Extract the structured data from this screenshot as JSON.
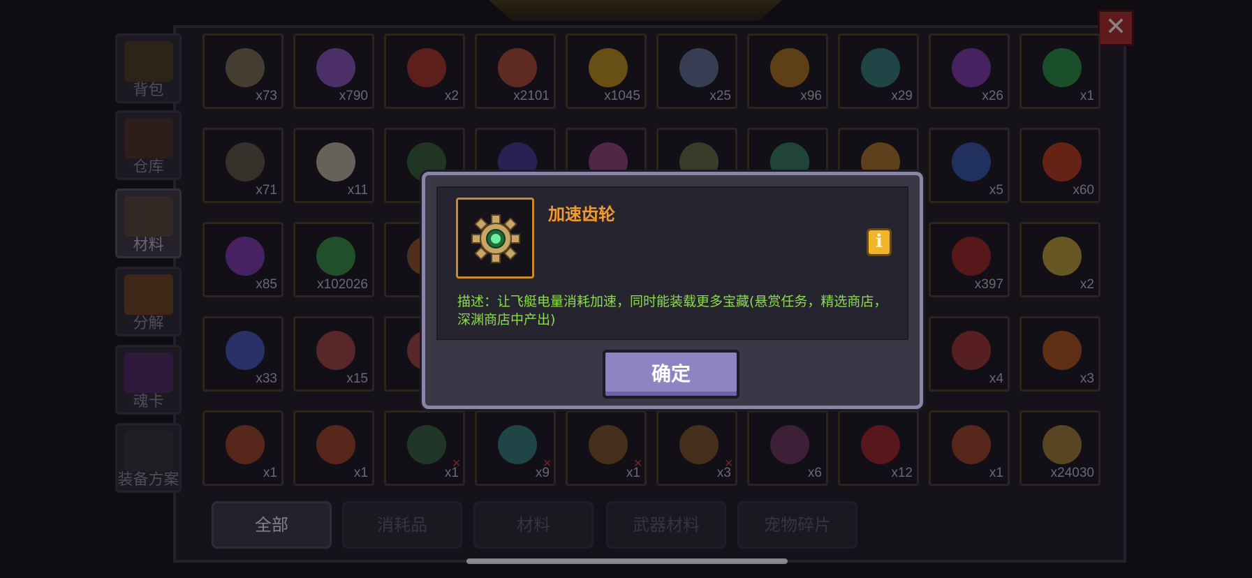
{
  "close_label": "✕",
  "side_tabs": [
    {
      "label": "背包",
      "icon": "chest-icon",
      "color": "#6a4a1a"
    },
    {
      "label": "仓库",
      "icon": "storage-icon",
      "color": "#6a3a1a"
    },
    {
      "label": "材料",
      "icon": "materials-icon",
      "color": "#6a5030"
    },
    {
      "label": "分解",
      "icon": "disassemble-icon",
      "color": "#a05a10"
    },
    {
      "label": "魂卡",
      "icon": "soul-card-icon",
      "color": "#6a2a8a"
    },
    {
      "label": "装备方案",
      "icon": "equipment-plan-icon",
      "color": "#3a3a3a"
    }
  ],
  "active_side_tab": 2,
  "grid": {
    "rows": [
      [
        "x73",
        "x790",
        "x2",
        "x2101",
        "x1045",
        "x25",
        "x96",
        "x29",
        "x26",
        "x1"
      ],
      [
        "x71",
        "x11",
        "",
        "",
        "",
        "",
        "",
        "",
        "x5",
        "x60"
      ],
      [
        "x85",
        "x102026",
        "",
        "",
        "",
        "",
        "",
        "",
        "x397",
        "x2"
      ],
      [
        "x33",
        "x15",
        "",
        "",
        "",
        "",
        "",
        "",
        "x4",
        "x3"
      ],
      [
        "x1",
        "x1",
        "x1",
        "x9",
        "x1",
        "x3",
        "x6",
        "x12",
        "x1",
        "x24030"
      ]
    ],
    "colors": [
      [
        "#8a7a5a",
        "#9a5ad0",
        "#b83a2a",
        "#c0503a",
        "#d0a020",
        "#6a7aa0",
        "#c08020",
        "#3a8a8a",
        "#8a40c0",
        "#2aa04a"
      ],
      [
        "#6a6050",
        "#d0c8b0",
        "#3a6a3a",
        "#4a40a0",
        "#a04a8a",
        "#6a7a4a",
        "#3a8a6a",
        "#c08030",
        "#3a60c0",
        "#d04020"
      ],
      [
        "#8a40c0",
        "#3aa04a",
        "#a05a30",
        "",
        "",
        "",
        "",
        "",
        "#b02a2a",
        "#d0b040"
      ],
      [
        "#4a60d0",
        "#b04a4a",
        "#b04a4a",
        "",
        "",
        "",
        "",
        "",
        "#b03a3a",
        "#c05a20"
      ],
      [
        "#b04a2a",
        "#b04a2a",
        "#3a6a4a",
        "#3a8a8a",
        "#8a5a2a",
        "#8a5a2a",
        "#7a3a6a",
        "#b02a2a",
        "#b04a2a",
        "#b08a40"
      ]
    ],
    "locked": [
      [
        4,
        2
      ],
      [
        4,
        3
      ],
      [
        4,
        4
      ],
      [
        4,
        5
      ]
    ]
  },
  "filter_tabs": [
    "全部",
    "消耗品",
    "材料",
    "武器材料",
    "宠物碎片"
  ],
  "active_filter": 0,
  "dialog": {
    "item_name": "加速齿轮",
    "item_icon": "gear-icon",
    "info_label": "i",
    "description": "描述：让飞艇电量消耗加速，同时能装载更多宝藏(悬赏任务，精选商店，深渊商店中产出)",
    "confirm_label": "确定"
  },
  "colors": {
    "accent_name": "#f29a2e",
    "description": "#8bdc4a",
    "button": "#8e84c4",
    "close": "#a62a2a"
  }
}
